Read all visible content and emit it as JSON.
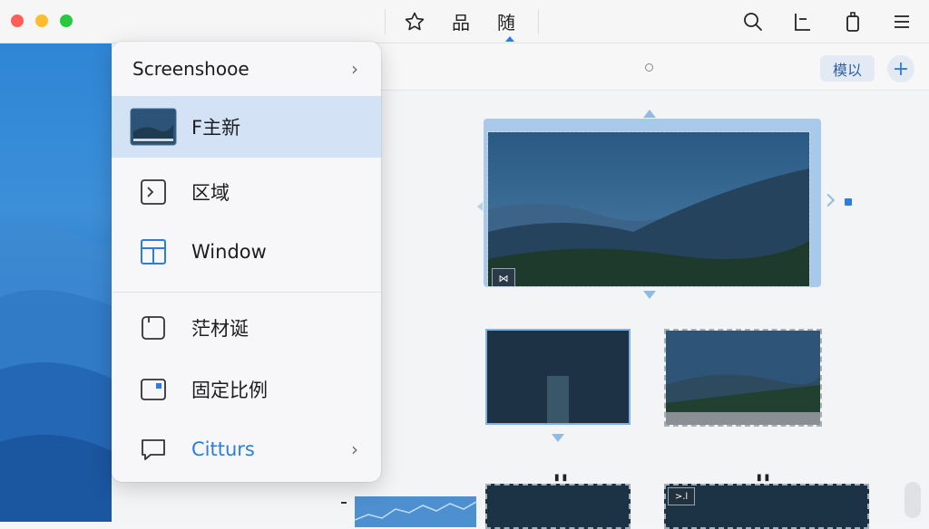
{
  "window": {
    "traffic_lights": [
      "close",
      "minimize",
      "zoom"
    ]
  },
  "toolbar": {
    "icons": [
      "star-icon",
      "grid-icon",
      "sequence-icon",
      "search-icon",
      "chart-icon",
      "clipboard-icon",
      "list-icon"
    ],
    "active_glyph": "随",
    "grid_glyph": "品"
  },
  "canvas": {
    "mode_button": "模以",
    "add_button": "+"
  },
  "menu": {
    "title": "Screenshooe",
    "items": [
      {
        "label": "F主新",
        "icon": "thumbnail-icon",
        "selected": true
      },
      {
        "label": "区域",
        "icon": "region-capture-icon"
      },
      {
        "label": "Window",
        "icon": "window-icon"
      },
      {
        "label": "茫材诞",
        "icon": "crop-frame-icon"
      },
      {
        "label": "固定比例",
        "icon": "fixed-ratio-icon"
      },
      {
        "label": "Citturs",
        "icon": "chat-bubble-icon",
        "submenu": true
      }
    ]
  },
  "colors": {
    "accent": "#2b7de1",
    "selection": "#d3e3f5",
    "frame_highlight": "#a9c9ea"
  }
}
